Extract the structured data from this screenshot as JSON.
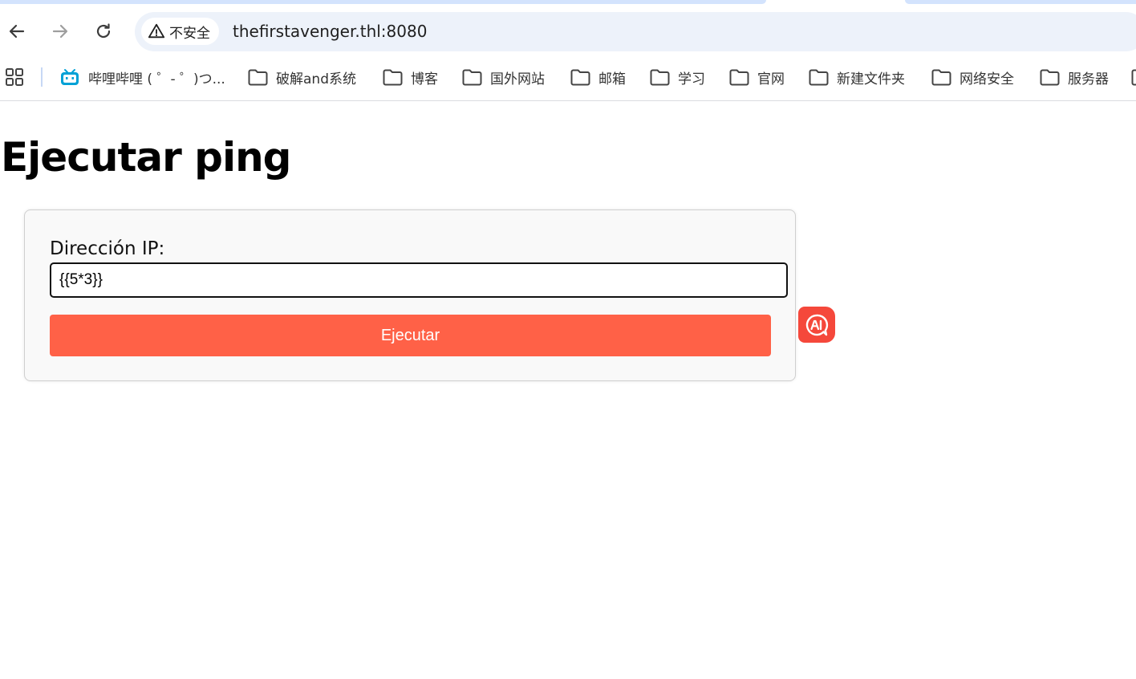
{
  "browser": {
    "security_label": "不安全",
    "url": "thefirstavenger.thl:8080",
    "bookmarks": [
      {
        "label": "哔哩哔哩 ( ゜- ゜)つ...",
        "icon": "bilibili-icon"
      },
      {
        "label": "破解and系统",
        "icon": "folder-icon"
      },
      {
        "label": "博客",
        "icon": "folder-icon"
      },
      {
        "label": "国外网站",
        "icon": "folder-icon"
      },
      {
        "label": "邮箱",
        "icon": "folder-icon"
      },
      {
        "label": "学习",
        "icon": "folder-icon"
      },
      {
        "label": "官网",
        "icon": "folder-icon"
      },
      {
        "label": "新建文件夹",
        "icon": "folder-icon"
      },
      {
        "label": "网络安全",
        "icon": "folder-icon"
      },
      {
        "label": "服务器",
        "icon": "folder-icon"
      }
    ]
  },
  "page": {
    "title": "Ejecutar ping",
    "form": {
      "ip_label": "Dirección IP:",
      "ip_value": "{{5*3}}",
      "submit_label": "Ejecutar"
    }
  },
  "colors": {
    "accent": "#ff6147",
    "ai_widget": "#f5483b",
    "omnibox": "#edf2fa"
  }
}
